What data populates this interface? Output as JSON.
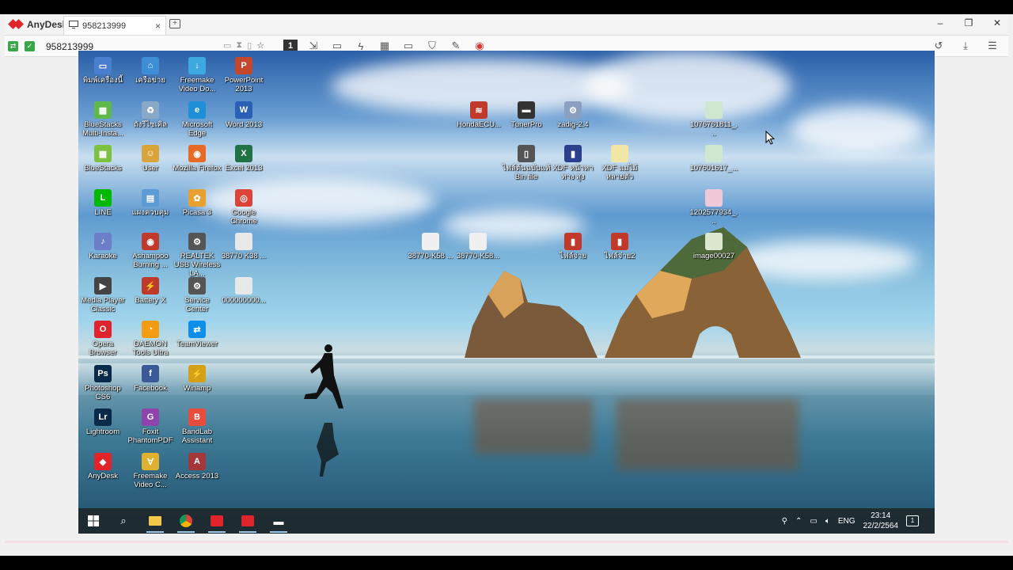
{
  "app": {
    "name": "AnyDesk"
  },
  "tab": {
    "label": "958213999",
    "close": "×"
  },
  "address": {
    "value": "958213999"
  },
  "toolbar": {
    "monitor_number": "1"
  },
  "window_controls": {
    "minimize": "–",
    "maximize": "❐",
    "close": "✕"
  },
  "desktop": {
    "icons": [
      {
        "label": "พิมพ์เครื่องนี้",
        "color": "#4a7fd0",
        "glyph": "▭"
      },
      {
        "label": "เครือข่าย",
        "color": "#3d8ed6",
        "glyph": "⌂"
      },
      {
        "label": "Freemake Video Do...",
        "color": "#3ea9e0",
        "glyph": "↓"
      },
      {
        "label": "PowerPoint 2013",
        "color": "#c4472b",
        "glyph": "P"
      },
      {
        "label": "BlueStacks Multi-Insta...",
        "color": "#5fb84a",
        "glyph": "▦"
      },
      {
        "label": "ถังรีไซเคิล",
        "color": "#8aa8c8",
        "glyph": "♻"
      },
      {
        "label": "Microsoft Edge",
        "color": "#1f8fd8",
        "glyph": "e"
      },
      {
        "label": "Word 2013",
        "color": "#2b5fb4",
        "glyph": "W"
      },
      {
        "label": "BlueStacks",
        "color": "#7cc142",
        "glyph": "▦"
      },
      {
        "label": "User",
        "color": "#d9a53a",
        "glyph": "☺"
      },
      {
        "label": "Mozilla Firefox",
        "color": "#e66a25",
        "glyph": "◉"
      },
      {
        "label": "Excel 2013",
        "color": "#207245",
        "glyph": "X"
      },
      {
        "label": "LINE",
        "color": "#00b900",
        "glyph": "L"
      },
      {
        "label": "แผงควบคุม",
        "color": "#5d9bd5",
        "glyph": "▤"
      },
      {
        "label": "Picasa 3",
        "color": "#e8a030",
        "glyph": "✿"
      },
      {
        "label": "Google Chrome",
        "color": "#db4437",
        "glyph": "◎"
      },
      {
        "label": "Karaoke",
        "color": "#6a7fc8",
        "glyph": "♪"
      },
      {
        "label": "Ashampoo Burning ...",
        "color": "#c0392b",
        "glyph": "◉"
      },
      {
        "label": "REALTEK USB Wireless LA...",
        "color": "#555555",
        "glyph": "⚙"
      },
      {
        "label": "38770 K38 ...",
        "color": "#e8e8e8",
        "glyph": ""
      },
      {
        "label": "Media Player Classic",
        "color": "#444444",
        "glyph": "▶"
      },
      {
        "label": "Battery X",
        "color": "#c0392b",
        "glyph": "⚡"
      },
      {
        "label": "Service Center",
        "color": "#555555",
        "glyph": "⚙"
      },
      {
        "label": "000000000...",
        "color": "#e8e8e8",
        "glyph": ""
      },
      {
        "label": "Opera Browser",
        "color": "#e0232f",
        "glyph": "O"
      },
      {
        "label": "DAEMON Tools Ultra",
        "color": "#f39c12",
        "glyph": "◔"
      },
      {
        "label": "TeamViewer",
        "color": "#0e8ee9",
        "glyph": "⇄"
      },
      {
        "label": "Photoshop CS6",
        "color": "#0a2a4a",
        "glyph": "Ps"
      },
      {
        "label": "Facebook",
        "color": "#3b5998",
        "glyph": "f"
      },
      {
        "label": "Winamp",
        "color": "#d4a017",
        "glyph": "⚡"
      },
      {
        "label": "Lightroom",
        "color": "#0a2a4a",
        "glyph": "Lr"
      },
      {
        "label": "Foxit PhantomPDF",
        "color": "#8e44ad",
        "glyph": "G"
      },
      {
        "label": "BandLab Assistant",
        "color": "#e74c3c",
        "glyph": "B"
      },
      {
        "label": "AnyDesk",
        "color": "#e0242a",
        "glyph": "◆"
      },
      {
        "label": "Freemake Video C...",
        "color": "#e0b030",
        "glyph": "∀"
      },
      {
        "label": "Access 2013",
        "color": "#a4373a",
        "glyph": "A"
      },
      {
        "label": "HondaECU...",
        "color": "#c0392b",
        "glyph": "≋"
      },
      {
        "label": "TunerPro",
        "color": "#333333",
        "glyph": "▬"
      },
      {
        "label": "zadig-2.4",
        "color": "#8aa0c0",
        "glyph": "⚙"
      },
      {
        "label": "1076761811_...",
        "color": "#cfe6cf",
        "glyph": ""
      },
      {
        "label": "ไฟล์ต้นฉบับแท้ Bin file",
        "color": "#555555",
        "glyph": "▯"
      },
      {
        "label": "XDF หน้าหาทาง สูง",
        "color": "#2b3f8c",
        "glyph": "▮"
      },
      {
        "label": "XDF แม่ไม้ หลายตัว",
        "color": "#f2e6a6",
        "glyph": ""
      },
      {
        "label": "107601617_...",
        "color": "#cfe6cf",
        "glyph": ""
      },
      {
        "label": "1202577934_...",
        "color": "#f0c8d8",
        "glyph": ""
      },
      {
        "label": "38770-K58 ...",
        "color": "#f0f0f0",
        "glyph": ""
      },
      {
        "label": "38770-K58...",
        "color": "#f0f0f0",
        "glyph": ""
      },
      {
        "label": "ไฟล์จ่าย",
        "color": "#c0392b",
        "glyph": "▮"
      },
      {
        "label": "ไฟล์จ่าย2",
        "color": "#c0392b",
        "glyph": "▮"
      },
      {
        "label": "image00027",
        "color": "#dde6cf",
        "glyph": ""
      }
    ]
  },
  "taskbar": {
    "lang": "ENG",
    "time": "23:14",
    "date": "22/2/2564",
    "notif_count": "1"
  }
}
